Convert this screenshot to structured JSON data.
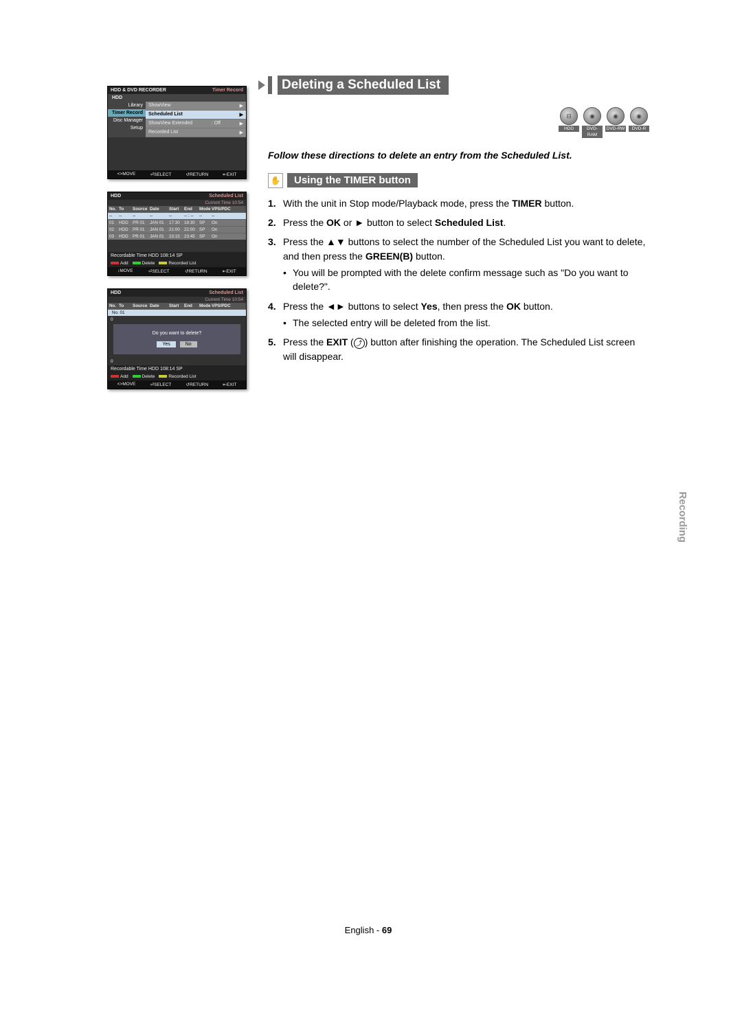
{
  "header": {
    "title": "Deleting a Scheduled List",
    "intro": "Follow these directions to delete an entry from the Scheduled List.",
    "subtitle": "Using the TIMER button"
  },
  "media": [
    "HDD",
    "DVD-RAM",
    "DVD-RW",
    "DVD-R"
  ],
  "osd1": {
    "title_left": "HDD & DVD RECORDER",
    "title_right": "Timer Record",
    "sub": "HDD",
    "left_menu": [
      "Library",
      "Timer Record",
      "Disc Manager",
      "Setup"
    ],
    "right_menu": [
      {
        "label": "ShowView",
        "value": "",
        "arrow": true
      },
      {
        "label": "Scheduled List",
        "value": "",
        "arrow": true,
        "sel": true
      },
      {
        "label": "ShowView Extended",
        "value": ": Off",
        "arrow": true
      },
      {
        "label": "Recorded List",
        "value": "",
        "arrow": true
      }
    ],
    "footer": [
      "<>MOVE",
      "⏎SELECT",
      "↺RETURN",
      "⇤EXIT"
    ]
  },
  "osd_table": {
    "sub": "HDD",
    "title_right": "Scheduled List",
    "current_time_label": "Current Time 10:54",
    "cols": [
      "No.",
      "To",
      "Source",
      "Date",
      "Start",
      "End",
      "Mode",
      "VPS/PDC"
    ],
    "placeholder_row": [
      "--",
      "--",
      "--",
      "--",
      "--",
      "-- : --",
      "--",
      "--"
    ],
    "rows": [
      [
        "01",
        "HDD",
        "PR 01",
        "JAN 01",
        "17:30",
        "18:30",
        "SP",
        "On"
      ],
      [
        "02",
        "HDD",
        "PR 01",
        "JAN 01",
        "21:00",
        "22:00",
        "SP",
        "On"
      ],
      [
        "03",
        "HDD",
        "PR 01",
        "JAN 01",
        "23:15",
        "23:45",
        "SP",
        "On"
      ]
    ],
    "recordable": "Recordable Time   HDD  108:14 SP",
    "legend": [
      "Add",
      "Delete",
      "Recorded List"
    ],
    "footer": [
      "↕MOVE",
      "⏎SELECT",
      "↺RETURN",
      "⇤EXIT"
    ]
  },
  "osd_delete": {
    "sub": "HDD",
    "title_right": "Scheduled List",
    "current_time_label": "Current Time 10:54",
    "sel_row_label": "No. 01",
    "dialog_text": "Do you want to delete?",
    "yes": "Yes",
    "no": "No",
    "recordable": "Recordable Time   HDD  108:14 SP",
    "legend": [
      "Add",
      "Delete",
      "Recorded List"
    ],
    "footer": [
      "<>MOVE",
      "⏎SELECT",
      "↺RETURN",
      "⇤EXIT"
    ]
  },
  "steps": {
    "s1a": "With the unit in Stop mode/Playback mode, press the ",
    "s1b": "TIMER",
    "s1c": " button.",
    "s2a": "Press the ",
    "s2b": "OK",
    "s2c": " or ► button to select ",
    "s2d": "Scheduled List",
    "s2e": ".",
    "s3a": "Press the ▲▼ buttons to select the number of the Scheduled List you want to delete, and then press the ",
    "s3b": "GREEN(B)",
    "s3c": " button.",
    "s3bullet": "You will be prompted with the delete confirm message such as \"Do you want to delete?\".",
    "s4a": "Press the ◄► buttons to select ",
    "s4b": "Yes",
    "s4c": ", then press the ",
    "s4d": "OK",
    "s4e": " button.",
    "s4bullet": "The selected entry will be deleted from the list.",
    "s5a": "Press the ",
    "s5b": "EXIT",
    "s5c": " (",
    "s5d": ") button after finishing the operation. The Scheduled List screen will disappear."
  },
  "sidecap": "Recording",
  "footer": {
    "lang": "English",
    "sep": " - ",
    "page": "69"
  }
}
